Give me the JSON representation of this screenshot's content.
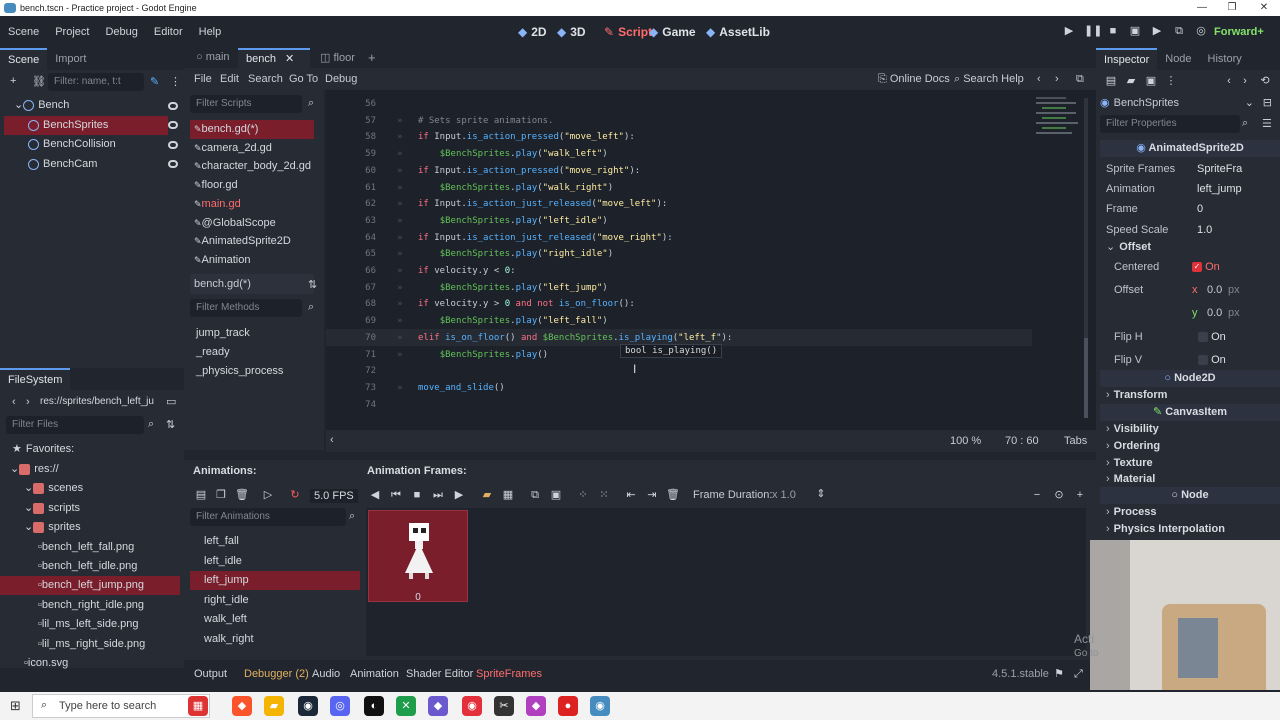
{
  "window_title": "bench.tscn - Practice project - Godot Engine",
  "menu": [
    "Scene",
    "Project",
    "Debug",
    "Editor",
    "Help"
  ],
  "workspaces": [
    {
      "icon": "◆",
      "label": "2D"
    },
    {
      "icon": "◆",
      "label": "3D"
    },
    {
      "icon": "✎",
      "label": "Script"
    },
    {
      "icon": "◆",
      "label": "Game"
    },
    {
      "icon": "◆",
      "label": "AssetLib"
    }
  ],
  "renderer": "Forward+",
  "scene_tabs": [
    "Scene",
    "Import"
  ],
  "scene_filter_placeholder": "Filter: name, t:t",
  "scene_tree": [
    {
      "label": "Bench",
      "indent": 0,
      "color": "#8ab4f8"
    },
    {
      "label": "BenchSprites",
      "indent": 1,
      "color": "#8ab4f8",
      "selected": true
    },
    {
      "label": "BenchCollision",
      "indent": 1,
      "color": "#8ab4f8"
    },
    {
      "label": "BenchCam",
      "indent": 1,
      "color": "#8ab4f8"
    }
  ],
  "editor_tabs": [
    "main",
    "bench",
    "floor"
  ],
  "script_menu": [
    "File",
    "Edit",
    "Search",
    "Go To",
    "Debug"
  ],
  "online_docs": "Online Docs",
  "search_help": "Search Help",
  "filter_scripts": "Filter Scripts",
  "scripts": [
    {
      "label": "bench.gd(*)",
      "selected": true
    },
    {
      "label": "camera_2d.gd"
    },
    {
      "label": "character_body_2d.gd"
    },
    {
      "label": "floor.gd"
    },
    {
      "label": "main.gd",
      "red": true
    },
    {
      "label": "@GlobalScope"
    },
    {
      "label": "AnimatedSprite2D"
    },
    {
      "label": "Animation"
    }
  ],
  "current_script": "bench.gd(*)",
  "filter_methods": "Filter Methods",
  "methods": [
    "jump_track",
    "_ready",
    "_physics_process"
  ],
  "code_lines": [
    {
      "n": "56",
      "html": ""
    },
    {
      "n": "57",
      "html": "<span class='cmt'># Sets sprite animations.</span>"
    },
    {
      "n": "58",
      "html": "<span class='kw'>if</span> Input.<span class='fn'>is_action_pressed</span>(<span class='str'>\"move_left\"</span>):"
    },
    {
      "n": "59",
      "html": "    <span class='node'>$BenchSprites</span>.<span class='fn'>play</span>(<span class='str'>\"walk_left\"</span>)"
    },
    {
      "n": "60",
      "html": "<span class='kw'>if</span> Input.<span class='fn'>is_action_pressed</span>(<span class='str'>\"move_right\"</span>):"
    },
    {
      "n": "61",
      "html": "    <span class='node'>$BenchSprites</span>.<span class='fn'>play</span>(<span class='str'>\"walk_right\"</span>)"
    },
    {
      "n": "62",
      "html": "<span class='kw'>if</span> Input.<span class='fn'>is_action_just_released</span>(<span class='str'>\"move_left\"</span>):"
    },
    {
      "n": "63",
      "html": "    <span class='node'>$BenchSprites</span>.<span class='fn'>play</span>(<span class='str'>\"left_idle\"</span>)"
    },
    {
      "n": "64",
      "html": "<span class='kw'>if</span> Input.<span class='fn'>is_action_just_released</span>(<span class='str'>\"move_right\"</span>):"
    },
    {
      "n": "65",
      "html": "    <span class='node'>$BenchSprites</span>.<span class='fn'>play</span>(<span class='str'>\"right_idle\"</span>)"
    },
    {
      "n": "66",
      "html": "<span class='kw'>if</span> velocity.y &lt; <span class='num'>0</span>:"
    },
    {
      "n": "67",
      "html": "    <span class='node'>$BenchSprites</span>.<span class='fn'>play</span>(<span class='str'>\"left_jump\"</span>)"
    },
    {
      "n": "68",
      "html": "<span class='kw'>if</span> velocity.y &gt; <span class='num'>0</span> <span class='kw'>and not</span> <span class='fn'>is_on_floor</span>():"
    },
    {
      "n": "69",
      "html": "    <span class='node'>$BenchSprites</span>.<span class='fn'>play</span>(<span class='str'>\"left_fall\"</span>)"
    },
    {
      "n": "70",
      "html": "<span class='kw'>elif</span> <span class='fn'>is_on_floor</span>() <span class='kw'>and</span> <span class='node'>$BenchSprites</span>.<span class='fn'>is_playing</span>(<span class='str'>\"left_f</span>\"):"
    },
    {
      "n": "71",
      "html": "    <span class='node'>$BenchSprites</span>.<span class='fn'>play</span>()"
    },
    {
      "n": "72",
      "html": ""
    },
    {
      "n": "73",
      "html": "<span class='fn'>move_and_slide</span>()"
    },
    {
      "n": "74",
      "html": ""
    }
  ],
  "tooltip": "bool is_playing()",
  "zoom": "100 %",
  "cursor_pos": "70 : 60",
  "indent_mode": "Tabs",
  "filesystem_title": "FileSystem",
  "fs_path": "res://sprites/bench_left_ju",
  "filter_files": "Filter Files",
  "favorites": "Favorites:",
  "fs_tree": [
    {
      "label": "res://",
      "indent": 0,
      "type": "folder"
    },
    {
      "label": "scenes",
      "indent": 1,
      "type": "folder"
    },
    {
      "label": "scripts",
      "indent": 1,
      "type": "folder"
    },
    {
      "label": "sprites",
      "indent": 1,
      "type": "folder"
    },
    {
      "label": "bench_left_fall.png",
      "indent": 2,
      "type": "file"
    },
    {
      "label": "bench_left_idle.png",
      "indent": 2,
      "type": "file"
    },
    {
      "label": "bench_left_jump.png",
      "indent": 2,
      "type": "file",
      "selected": true
    },
    {
      "label": "bench_right_idle.png",
      "indent": 2,
      "type": "file"
    },
    {
      "label": "lil_ms_left_side.png",
      "indent": 2,
      "type": "file"
    },
    {
      "label": "lil_ms_right_side.png",
      "indent": 2,
      "type": "file"
    },
    {
      "label": "icon.svg",
      "indent": 1,
      "type": "file"
    }
  ],
  "animations_label": "Animations:",
  "anim_frames_label": "Animation Frames:",
  "fps": "5.0 FPS",
  "frame_duration_label": "Frame Duration:",
  "frame_duration": "x 1.0",
  "filter_animations": "Filter Animations",
  "animations": [
    {
      "label": "left_fall"
    },
    {
      "label": "left_idle"
    },
    {
      "label": "left_jump",
      "selected": true
    },
    {
      "label": "right_idle"
    },
    {
      "label": "walk_left"
    },
    {
      "label": "walk_right"
    }
  ],
  "frame_index": "0",
  "bottom_tabs": [
    "Output",
    "Debugger (2)",
    "Audio",
    "Animation",
    "Shader Editor",
    "SpriteFrames"
  ],
  "version": "4.5.1.stable",
  "inspector_tabs": [
    "Inspector",
    "Node",
    "History"
  ],
  "inspector_node": "BenchSprites",
  "filter_properties": "Filter Properties",
  "class_header": "AnimatedSprite2D",
  "props": [
    {
      "k": "Sprite Frames",
      "v": "SpriteFra"
    },
    {
      "k": "Animation",
      "v": "left_jump"
    },
    {
      "k": "Frame",
      "v": "0"
    },
    {
      "k": "Speed Scale",
      "v": "1.0"
    }
  ],
  "offset_cat": "Offset",
  "centered_label": "Centered",
  "centered_value": "On",
  "offset_label": "Offset",
  "offset_x_label": "x",
  "offset_x": "0.0",
  "offset_y_label": "y",
  "offset_y": "0.0",
  "px": "px",
  "flip_h": "Flip H",
  "flip_v": "Flip V",
  "flip_on": "On",
  "node2d": "Node2D",
  "transform": "Transform",
  "canvasitem": "CanvasItem",
  "ci_cats": [
    "Visibility",
    "Ordering",
    "Texture",
    "Material"
  ],
  "node": "Node",
  "node_cats": [
    "Process",
    "Physics Interpolation"
  ],
  "activate": "Acti",
  "goto": "Go to",
  "taskbar_search": "Type here to search"
}
